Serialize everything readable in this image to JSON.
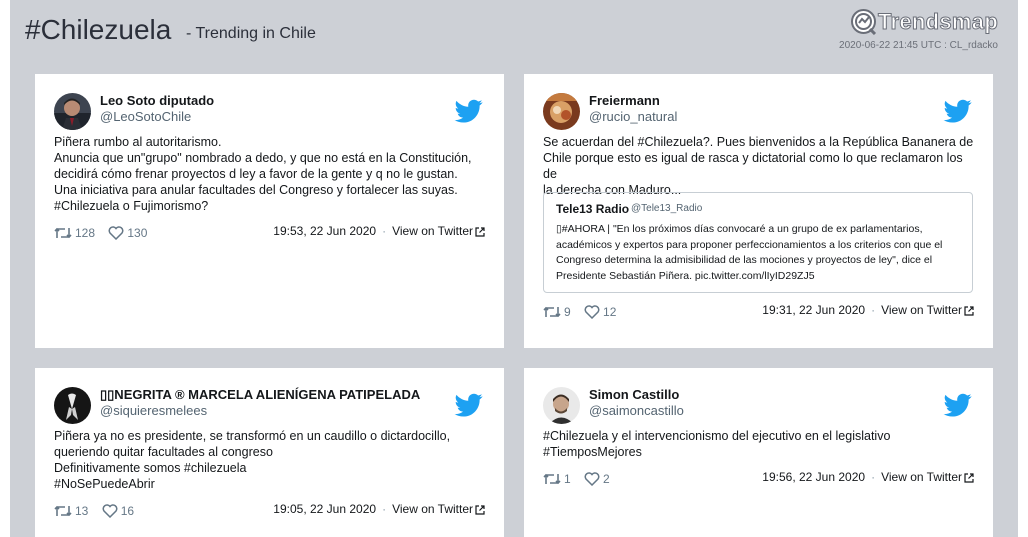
{
  "header": {
    "hashtag": "#Chilezuela",
    "subtitle": "- Trending in Chile",
    "brand": "Trendsmap",
    "meta": "2020-06-22 21:45 UTC : CL_rdacko"
  },
  "colors": {
    "accent": "#1da1f2",
    "frame": "#cdd0d6",
    "text": "#14171a",
    "muted": "#657786"
  },
  "tweets": [
    {
      "name": "Leo Soto diputado",
      "handle": "@LeoSotoChile",
      "lines": [
        "Piñera rumbo al autoritarismo.",
        "Anuncia que un\"grupo\" nombrado a dedo, y que no está en la Constitución,",
        "decidirá cómo frenar proyectos d ley a favor de la gente y q no le gustan.",
        "Una iniciativa para anular facultades del Congreso y fortalecer las suyas.",
        "#Chilezuela o Fujimorismo?"
      ],
      "retweets": "128",
      "likes": "130",
      "date": "19:53, 22 Jun 2020",
      "view": "View on Twitter"
    },
    {
      "name": "Freiermann",
      "handle": "@rucio_natural",
      "lines": [
        "Se acuerdan del #Chilezuela?. Pues bienvenidos a la República Bananera de",
        "Chile porque esto es igual de rasca y dictatorial como lo que reclamaron los de",
        "la derecha con Maduro..."
      ],
      "quote": {
        "name": "Tele13 Radio",
        "handle": "@Tele13_Radio",
        "lines": [
          "▯#AHORA | \"En los próximos días convocaré a un grupo de ex parlamentarios,",
          "académicos y expertos para proponer perfeccionamientos a los criterios con que el",
          "Congreso determina la admisibilidad de las mociones y proyectos de ley\", dice el",
          "Presidente Sebastián Piñera. pic.twitter.com/lIyID29ZJ5"
        ]
      },
      "retweets": "9",
      "likes": "12",
      "date": "19:31, 22 Jun 2020",
      "view": "View on Twitter"
    },
    {
      "name": "▯▯NEGRITA ® MARCELA ALIENÍGENA PATIPELADA",
      "handle": "@siquieresmelees",
      "lines": [
        "Piñera ya no es presidente, se transformó en un caudillo o dictardocillo,",
        "queriendo quitar facultades al congreso",
        "Definitivamente somos #chilezuela",
        "#NoSePuedeAbrir"
      ],
      "retweets": "13",
      "likes": "16",
      "date": "19:05, 22 Jun 2020",
      "view": "View on Twitter"
    },
    {
      "name": "Simon Castillo",
      "handle": "@saimoncastillo",
      "lines": [
        "#Chilezuela y el intervencionismo del ejecutivo en el legislativo",
        "#TiemposMejores"
      ],
      "retweets": "1",
      "likes": "2",
      "date": "19:56, 22 Jun 2020",
      "view": "View on Twitter"
    }
  ]
}
